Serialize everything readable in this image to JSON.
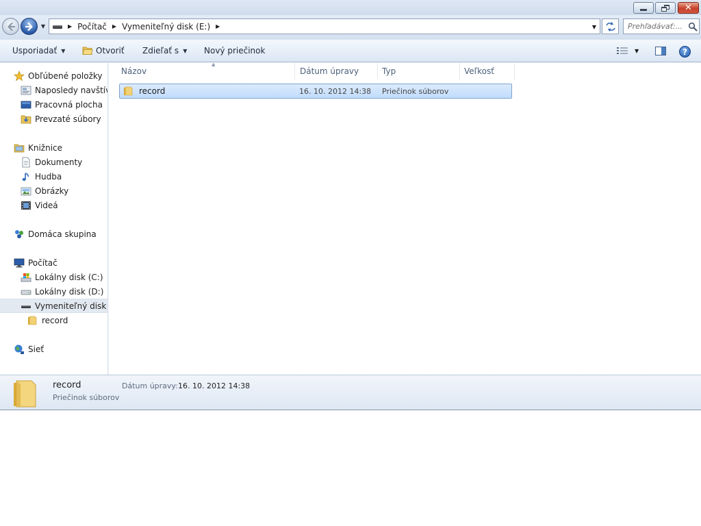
{
  "window": {
    "caption": {
      "minimize_glyph": "",
      "close_glyph": "✕"
    }
  },
  "address": {
    "crumbs": [
      "Počítač",
      "Vymeniteľný disk (E:)"
    ],
    "search_placeholder": "Prehľadávať:..."
  },
  "commandbar": {
    "organize": "Usporiadať",
    "open": "Otvoriť",
    "share": "Zdieľať s",
    "new_folder": "Nový priečinok",
    "help": "?"
  },
  "navpane": {
    "favorites": "Obľúbené položky",
    "recent": "Naposledy navštívené",
    "desktop": "Pracovná plocha",
    "downloads": "Prevzaté súbory",
    "libraries": "Knižnice",
    "documents": "Dokumenty",
    "music": "Hudba",
    "pictures": "Obrázky",
    "videos": "Videá",
    "homegroup": "Domáca skupina",
    "computer": "Počítač",
    "disk_c": "Lokálny disk (C:)",
    "disk_d": "Lokálny disk (D:)",
    "disk_e": "Vymeniteľný disk (E:)",
    "record": "record",
    "network": "Sieť"
  },
  "filelist": {
    "columns": {
      "name": "Názov",
      "date": "Dátum úpravy",
      "type": "Typ",
      "size": "Veľkosť"
    },
    "rows": [
      {
        "name": "record",
        "date": "16. 10. 2012 14:38",
        "type": "Priečinok súborov",
        "size": "",
        "selected": true
      }
    ]
  },
  "details": {
    "name": "record",
    "type": "Priečinok súborov",
    "date_label": "Dátum úpravy:",
    "date_value": "16. 10. 2012 14:38"
  },
  "colors": {
    "selection": "#c1dcfc",
    "selection_border": "#7da2ce",
    "folder": "#e8c45a",
    "accent_blue": "#2a5aa8",
    "close_red": "#c6402a"
  },
  "icons": {
    "folder": "folder-icon",
    "drive": "removable-drive-icon",
    "search": "search-icon",
    "refresh": "refresh-icon"
  }
}
